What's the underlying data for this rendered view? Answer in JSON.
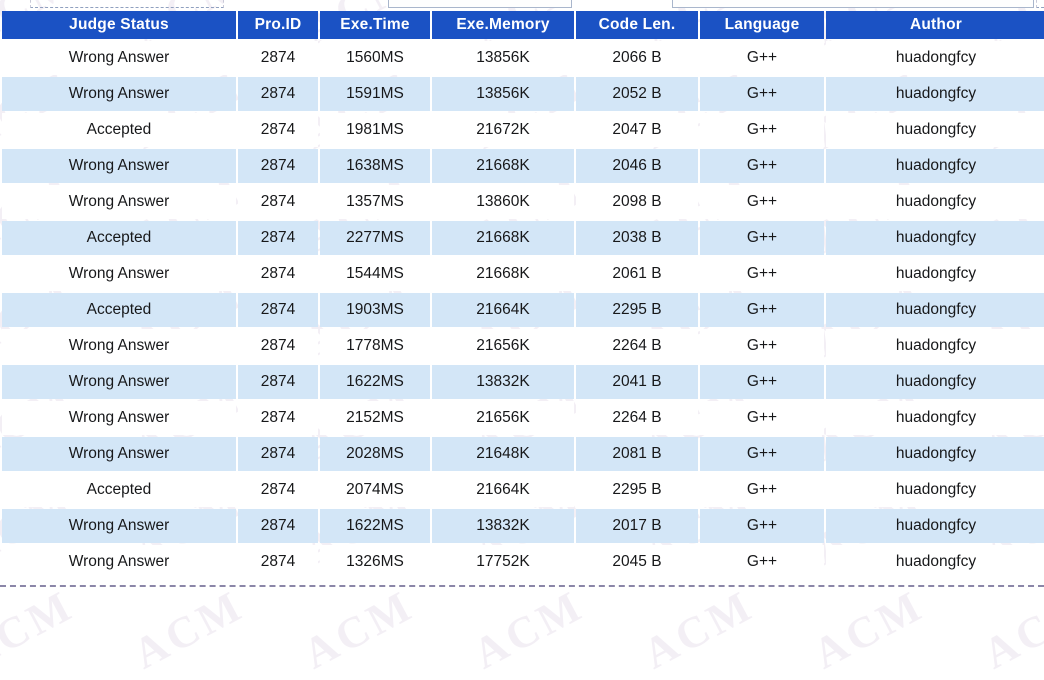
{
  "table": {
    "columns": [
      {
        "key": "status",
        "label": "Judge Status"
      },
      {
        "key": "pro_id",
        "label": "Pro.ID"
      },
      {
        "key": "exe_time",
        "label": "Exe.Time"
      },
      {
        "key": "exe_mem",
        "label": "Exe.Memory"
      },
      {
        "key": "code_len",
        "label": "Code Len."
      },
      {
        "key": "language",
        "label": "Language"
      },
      {
        "key": "author",
        "label": "Author"
      }
    ],
    "rows": [
      {
        "status": "Wrong Answer",
        "pro_id": "2874",
        "exe_time": "1560MS",
        "exe_mem": "13856K",
        "code_len": "2066 B",
        "language": "G++",
        "author": "huadongfcy"
      },
      {
        "status": "Wrong Answer",
        "pro_id": "2874",
        "exe_time": "1591MS",
        "exe_mem": "13856K",
        "code_len": "2052 B",
        "language": "G++",
        "author": "huadongfcy"
      },
      {
        "status": "Accepted",
        "pro_id": "2874",
        "exe_time": "1981MS",
        "exe_mem": "21672K",
        "code_len": "2047 B",
        "language": "G++",
        "author": "huadongfcy"
      },
      {
        "status": "Wrong Answer",
        "pro_id": "2874",
        "exe_time": "1638MS",
        "exe_mem": "21668K",
        "code_len": "2046 B",
        "language": "G++",
        "author": "huadongfcy"
      },
      {
        "status": "Wrong Answer",
        "pro_id": "2874",
        "exe_time": "1357MS",
        "exe_mem": "13860K",
        "code_len": "2098 B",
        "language": "G++",
        "author": "huadongfcy"
      },
      {
        "status": "Accepted",
        "pro_id": "2874",
        "exe_time": "2277MS",
        "exe_mem": "21668K",
        "code_len": "2038 B",
        "language": "G++",
        "author": "huadongfcy"
      },
      {
        "status": "Wrong Answer",
        "pro_id": "2874",
        "exe_time": "1544MS",
        "exe_mem": "21668K",
        "code_len": "2061 B",
        "language": "G++",
        "author": "huadongfcy"
      },
      {
        "status": "Accepted",
        "pro_id": "2874",
        "exe_time": "1903MS",
        "exe_mem": "21664K",
        "code_len": "2295 B",
        "language": "G++",
        "author": "huadongfcy"
      },
      {
        "status": "Wrong Answer",
        "pro_id": "2874",
        "exe_time": "1778MS",
        "exe_mem": "21656K",
        "code_len": "2264 B",
        "language": "G++",
        "author": "huadongfcy"
      },
      {
        "status": "Wrong Answer",
        "pro_id": "2874",
        "exe_time": "1622MS",
        "exe_mem": "13832K",
        "code_len": "2041 B",
        "language": "G++",
        "author": "huadongfcy"
      },
      {
        "status": "Wrong Answer",
        "pro_id": "2874",
        "exe_time": "2152MS",
        "exe_mem": "21656K",
        "code_len": "2264 B",
        "language": "G++",
        "author": "huadongfcy"
      },
      {
        "status": "Wrong Answer",
        "pro_id": "2874",
        "exe_time": "2028MS",
        "exe_mem": "21648K",
        "code_len": "2081 B",
        "language": "G++",
        "author": "huadongfcy"
      },
      {
        "status": "Accepted",
        "pro_id": "2874",
        "exe_time": "2074MS",
        "exe_mem": "21664K",
        "code_len": "2295 B",
        "language": "G++",
        "author": "huadongfcy"
      },
      {
        "status": "Wrong Answer",
        "pro_id": "2874",
        "exe_time": "1622MS",
        "exe_mem": "13832K",
        "code_len": "2017 B",
        "language": "G++",
        "author": "huadongfcy"
      },
      {
        "status": "Wrong Answer",
        "pro_id": "2874",
        "exe_time": "1326MS",
        "exe_mem": "17752K",
        "code_len": "2045 B",
        "language": "G++",
        "author": "huadongfcy"
      }
    ]
  },
  "colors": {
    "header_bg": "#1b52c4",
    "header_text": "#ffffff",
    "row_alt_bg": "#d3e6f7",
    "row_bg": "#ffffff",
    "accepted": "#e8202a",
    "wrong_answer": "#2f7a2f",
    "link": "#2b5cb8"
  },
  "watermark": {
    "text": "ACM"
  }
}
